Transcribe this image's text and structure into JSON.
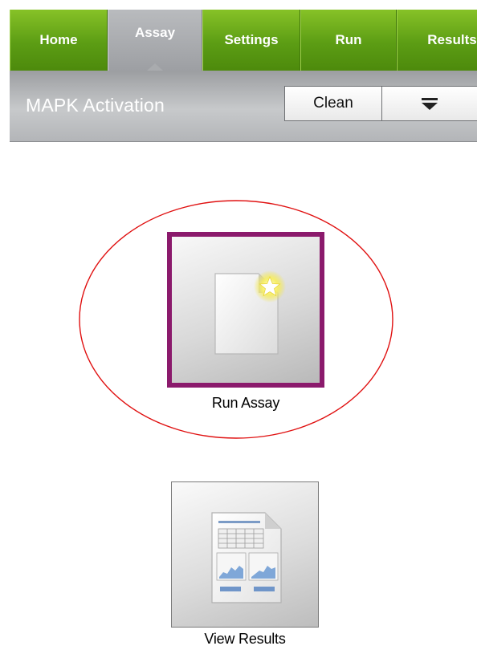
{
  "nav": {
    "tabs": [
      {
        "label": "Home"
      },
      {
        "label": "Assay"
      },
      {
        "label": "Settings"
      },
      {
        "label": "Run"
      },
      {
        "label": "Results"
      }
    ],
    "active_tab": "Assay"
  },
  "header": {
    "title": "MAPK Activation",
    "clean_label": "Clean"
  },
  "actions": {
    "run_assay_label": "Run Assay",
    "view_results_label": "View Results"
  },
  "colors": {
    "nav_green": "#5c9d14",
    "active_tab_gray": "#a9abae",
    "selection_border": "#8b1a6c",
    "highlight_ring": "#e01010"
  },
  "icons": {
    "run_assay": "new-document-star-icon",
    "view_results": "results-report-icon",
    "menu": "menu-dropdown-icon"
  }
}
